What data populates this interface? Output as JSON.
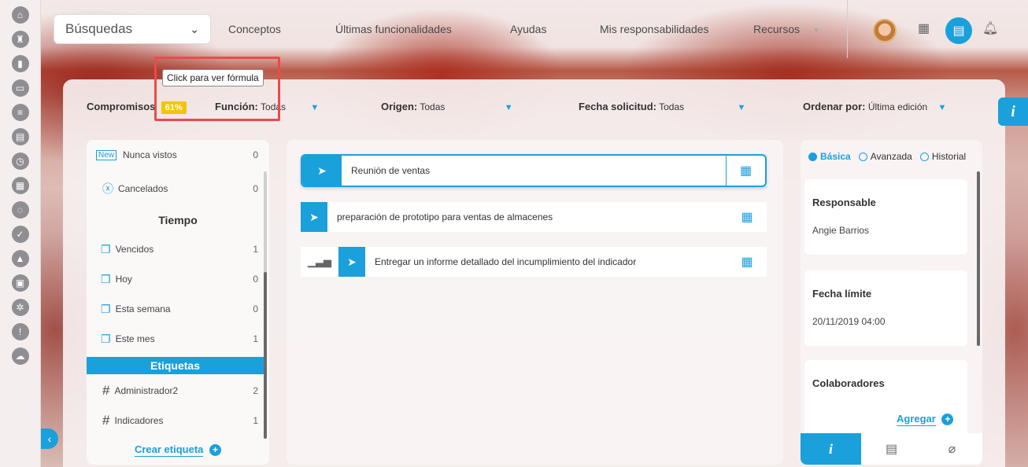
{
  "nav": {
    "search_label": "Búsquedas",
    "items": [
      "Conceptos",
      "Últimas funcionalidades",
      "Ayudas",
      "Mis responsabilidades",
      "Recursos"
    ]
  },
  "filters": {
    "compromisos_label": "Compromisos",
    "compromisos_pct": "61%",
    "funcion_label": "Función:",
    "funcion_value": "Todas",
    "origen_label": "Origen:",
    "origen_value": "Todas",
    "fecha_label": "Fecha solicitud:",
    "fecha_value": "Todas",
    "ordenar_label": "Ordenar por:",
    "ordenar_value": "Última edición"
  },
  "tooltip": "Click para ver fórmula",
  "left_panel": {
    "new_badge": "New",
    "rows_top": [
      {
        "label": "Nunca vistos",
        "count": "0"
      },
      {
        "label": "Cancelados",
        "count": "0"
      }
    ],
    "tiempo_heading": "Tiempo",
    "tiempo_rows": [
      {
        "label": "Vencidos",
        "count": "1"
      },
      {
        "label": "Hoy",
        "count": "0"
      },
      {
        "label": "Esta semana",
        "count": "0"
      },
      {
        "label": "Este mes",
        "count": "1"
      }
    ],
    "etiquetas_heading": "Etiquetas",
    "etiquetas_rows": [
      {
        "label": "Administrador2",
        "count": "2"
      },
      {
        "label": "Indicadores",
        "count": "1"
      }
    ],
    "crear_label": "Crear etiqueta"
  },
  "tasks": [
    {
      "label": "Reunión de ventas"
    },
    {
      "label": "preparación de prototipo para ventas de almacenes"
    },
    {
      "label": "Entregar un informe detallado del incumplimiento del indicador"
    }
  ],
  "right_panel": {
    "radio_basica": "Básica",
    "radio_avanzada": "Avanzada",
    "radio_historial": "Historial",
    "responsable_title": "Responsable",
    "responsable_value": "Angie Barrios",
    "fecha_title": "Fecha límite",
    "fecha_value": "20/11/2019 04:00",
    "colab_title": "Colaboradores",
    "agregar_label": "Agregar",
    "info_tab": "i"
  },
  "side_info": "i",
  "colors": {
    "accent": "#1aa0db",
    "badge": "#f5c400",
    "highlight": "#e84c4c"
  }
}
